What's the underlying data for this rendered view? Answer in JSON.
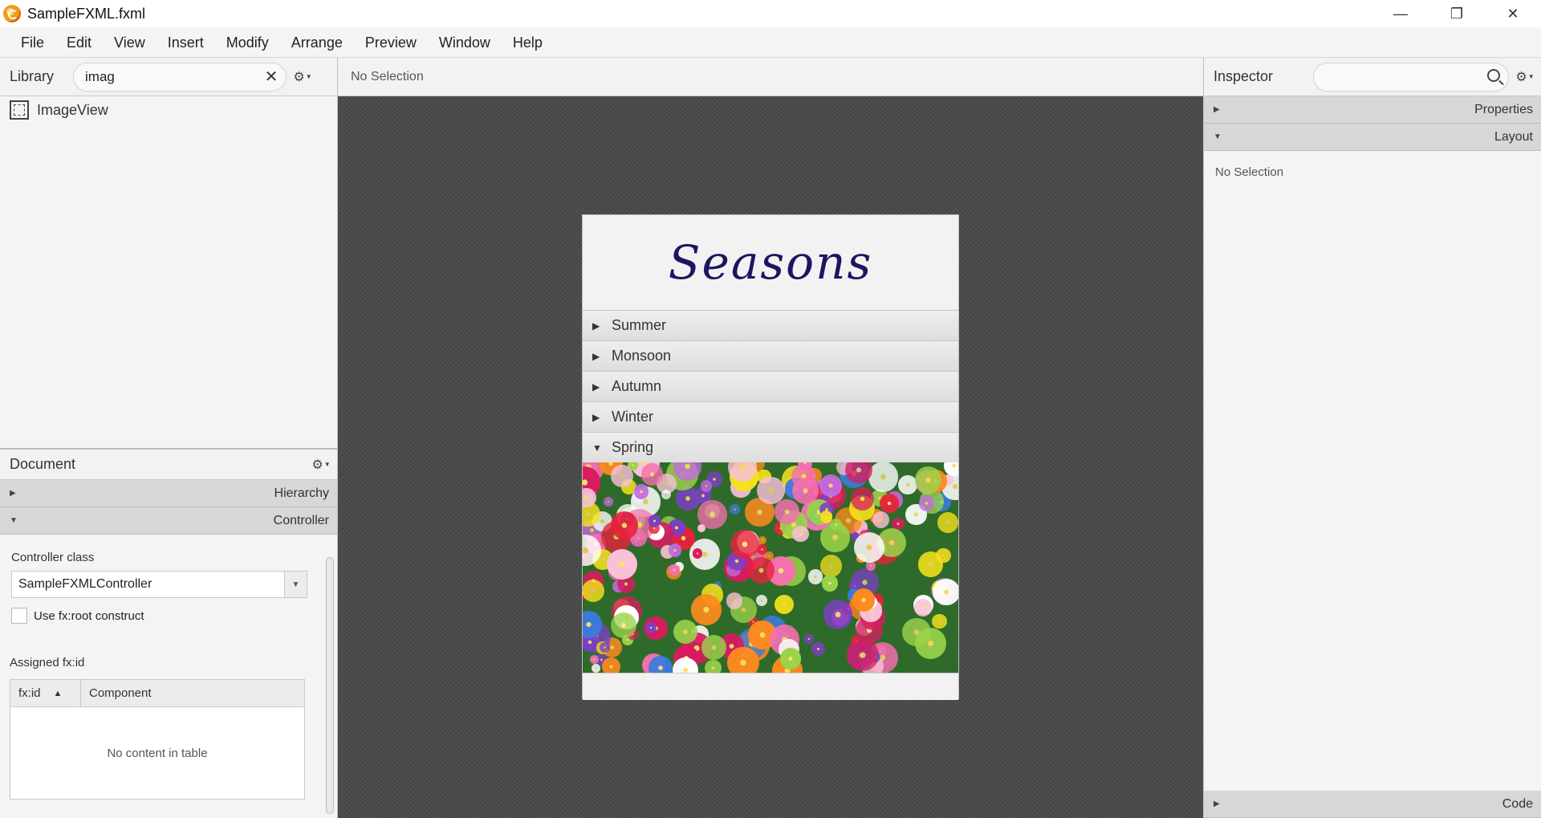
{
  "window": {
    "title": "SampleFXML.fxml",
    "controls": {
      "minimize": "—",
      "restore": "❐",
      "close": "✕"
    }
  },
  "menu": [
    "File",
    "Edit",
    "View",
    "Insert",
    "Modify",
    "Arrange",
    "Preview",
    "Window",
    "Help"
  ],
  "library": {
    "title": "Library",
    "search_value": "imag",
    "items": [
      {
        "label": "ImageView",
        "icon": "imageview-icon"
      }
    ]
  },
  "document": {
    "title": "Document",
    "sections": {
      "hierarchy": "Hierarchy",
      "controller": "Controller"
    },
    "controller_class_label": "Controller class",
    "controller_class_value": "SampleFXMLController",
    "use_fxroot_label": "Use fx:root construct",
    "assigned_label": "Assigned fx:id",
    "table": {
      "columns": [
        "fx:id",
        "Component"
      ],
      "empty_text": "No content in table"
    }
  },
  "center": {
    "selection_text": "No Selection",
    "stage": {
      "title": "Seasons",
      "panes": [
        {
          "label": "Summer",
          "expanded": false
        },
        {
          "label": "Monsoon",
          "expanded": false
        },
        {
          "label": "Autumn",
          "expanded": false
        },
        {
          "label": "Winter",
          "expanded": false
        },
        {
          "label": "Spring",
          "expanded": true
        }
      ]
    }
  },
  "inspector": {
    "title": "Inspector",
    "sections": {
      "properties": "Properties",
      "layout": "Layout",
      "code": "Code"
    },
    "no_selection": "No Selection"
  },
  "colors": {
    "title_accent": "#1c1560",
    "canvas_bg": "#4a4a4a"
  }
}
